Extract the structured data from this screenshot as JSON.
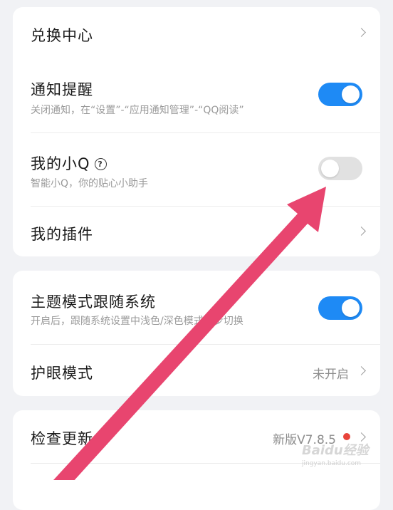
{
  "card1": {
    "exchange": {
      "title": "兑换中心"
    },
    "notify": {
      "title": "通知提醒",
      "subtitle": "关闭通知，在“设置”-“应用通知管理”-“QQ阅读”",
      "state": "on"
    },
    "xiaoq": {
      "title": "我的小Q",
      "subtitle": "智能小Q，你的贴心小助手",
      "help_glyph": "?",
      "state": "off"
    },
    "plugins": {
      "title": "我的插件"
    }
  },
  "card2": {
    "theme": {
      "title": "主题模式跟随系统",
      "subtitle": "开启后，跟随系统设置中浅色/深色模式同步切换",
      "state": "on"
    },
    "eye": {
      "title": "护眼模式",
      "value": "未开启"
    }
  },
  "card3": {
    "update": {
      "title": "检查更新",
      "value": "新版V7.8.5"
    }
  },
  "watermark": {
    "text": "Baidu经验",
    "sub": "jingyan.baidu.com"
  },
  "colors": {
    "toggle_on": "#1e8af5",
    "toggle_off": "#e1e1e1",
    "annotation_arrow": "#e8456f",
    "update_dot": "#e8443b"
  }
}
